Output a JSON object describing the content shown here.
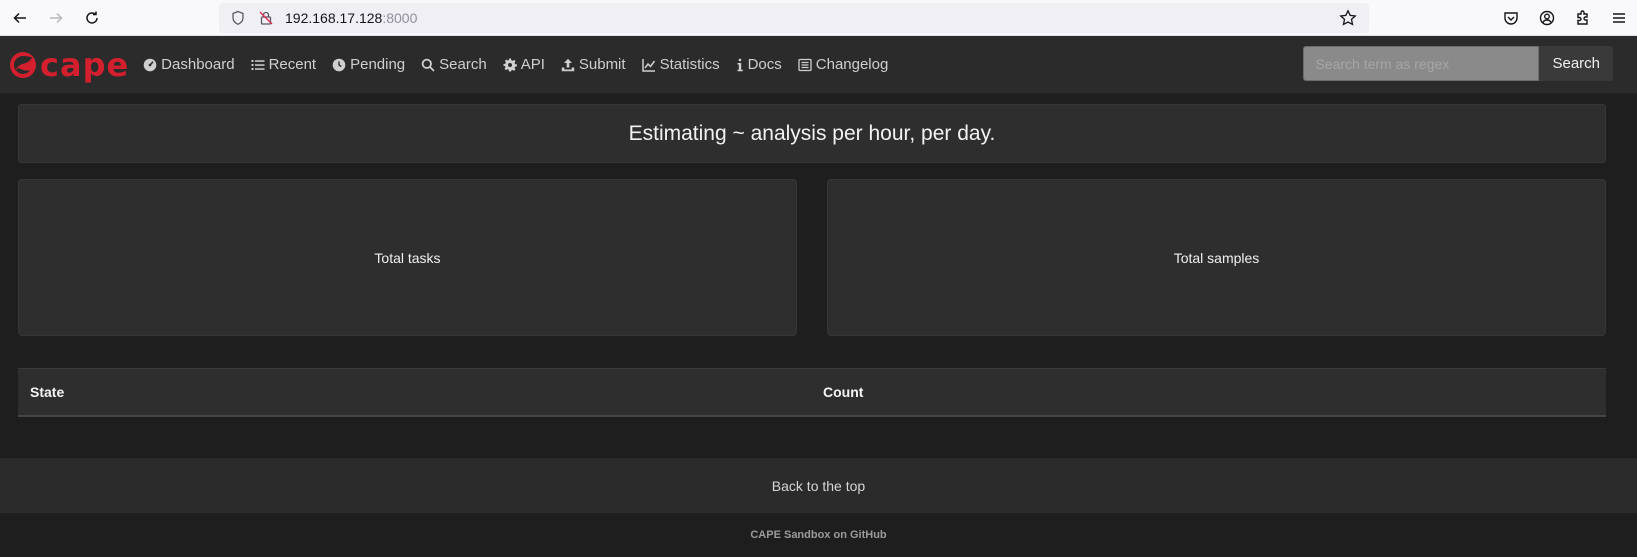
{
  "browser": {
    "url_host": "192.168.17.128",
    "url_port": ":8000"
  },
  "navbar": {
    "brand": "cape",
    "items": [
      {
        "label": "Dashboard",
        "icon": "dashboard-icon"
      },
      {
        "label": "Recent",
        "icon": "list-icon"
      },
      {
        "label": "Pending",
        "icon": "clock-icon"
      },
      {
        "label": "Search",
        "icon": "search-icon"
      },
      {
        "label": "API",
        "icon": "gear-icon"
      },
      {
        "label": "Submit",
        "icon": "upload-icon"
      },
      {
        "label": "Statistics",
        "icon": "chart-icon"
      },
      {
        "label": "Docs",
        "icon": "info-icon"
      },
      {
        "label": "Changelog",
        "icon": "changelog-icon"
      }
    ],
    "search": {
      "placeholder": "Search term as regex",
      "button_label": "Search"
    }
  },
  "main": {
    "headline": "Estimating ~ analysis per hour, per day.",
    "cards": {
      "total_tasks": "Total tasks",
      "total_samples": "Total samples"
    },
    "table": {
      "headers": [
        "State",
        "Count"
      ]
    }
  },
  "back_to_top": "Back to the top",
  "footer": "CAPE Sandbox on GitHub",
  "colors": {
    "brand_red": "#d31f2e",
    "page_bg": "#1e1e1e",
    "panel_bg": "#2e2e2e"
  }
}
